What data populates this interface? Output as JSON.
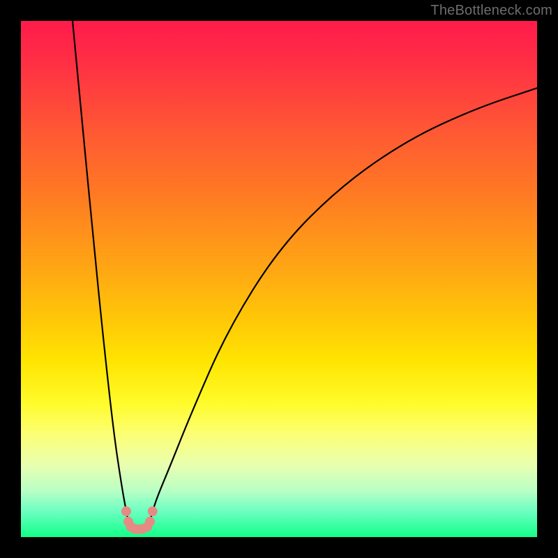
{
  "watermark": "TheBottleneck.com",
  "colors": {
    "frame": "#000000",
    "curve": "#000000",
    "marker": "#e58b83",
    "gradient_top": "#ff1b4b",
    "gradient_bottom": "#12ff88"
  },
  "chart_data": {
    "type": "line",
    "title": "",
    "xlabel": "",
    "ylabel": "",
    "xlim": [
      0,
      100
    ],
    "ylim": [
      0,
      100
    ],
    "grid": false,
    "legend": false,
    "series": [
      {
        "name": "left-curve",
        "x": [
          10,
          12,
          14,
          16,
          18,
          19.5,
          20.4,
          20.8,
          21.3
        ],
        "values": [
          100,
          79,
          58,
          38,
          20,
          10,
          5,
          3,
          2
        ]
      },
      {
        "name": "right-curve",
        "x": [
          24.5,
          25.0,
          25.5,
          26.5,
          29,
          33,
          40,
          50,
          62,
          75,
          88,
          100
        ],
        "values": [
          2,
          3,
          5,
          8,
          14,
          24,
          40,
          56,
          68,
          77,
          83,
          87
        ]
      },
      {
        "name": "bottom-tie",
        "x": [
          21.3,
          22.0,
          22.8,
          23.6,
          24.5
        ],
        "values": [
          2,
          1.6,
          1.5,
          1.6,
          2
        ]
      }
    ],
    "markers": {
      "name": "highlight-points",
      "points": [
        {
          "x": 20.4,
          "y": 5
        },
        {
          "x": 20.8,
          "y": 3
        },
        {
          "x": 21.3,
          "y": 2
        },
        {
          "x": 22.0,
          "y": 1.6
        },
        {
          "x": 22.8,
          "y": 1.5
        },
        {
          "x": 23.6,
          "y": 1.6
        },
        {
          "x": 24.5,
          "y": 2
        },
        {
          "x": 25.0,
          "y": 3
        },
        {
          "x": 25.5,
          "y": 5
        }
      ],
      "radius": 7
    }
  }
}
